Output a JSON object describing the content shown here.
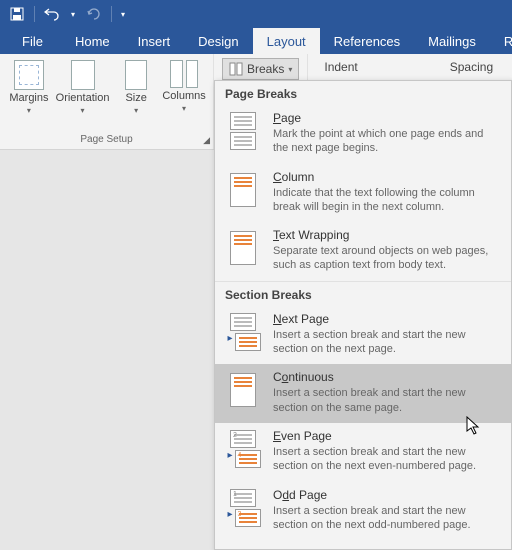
{
  "titlebar": {
    "save": "Save",
    "undo": "Undo",
    "redo": "Redo"
  },
  "tabs": {
    "file": "File",
    "home": "Home",
    "insert": "Insert",
    "design": "Design",
    "layout": "Layout",
    "references": "References",
    "mailings": "Mailings",
    "review": "Revie"
  },
  "ribbon": {
    "page_setup": {
      "margins": "Margins",
      "orientation": "Orientation",
      "size": "Size",
      "columns": "Columns",
      "label": "Page Setup"
    },
    "breaks_btn": "Breaks",
    "indent_label": "Indent",
    "spacing_label": "Spacing"
  },
  "dropdown": {
    "page_breaks_header": "Page Breaks",
    "section_breaks_header": "Section Breaks",
    "items": {
      "page": {
        "title_pre": "",
        "title_u": "P",
        "title_post": "age",
        "desc": "Mark the point at which one page ends and the next page begins."
      },
      "column": {
        "title_pre": "",
        "title_u": "C",
        "title_post": "olumn",
        "desc": "Indicate that the text following the column break will begin in the next column."
      },
      "text_wrapping": {
        "title_pre": "",
        "title_u": "T",
        "title_post": "ext Wrapping",
        "desc": "Separate text around objects on web pages, such as caption text from body text."
      },
      "next_page": {
        "title_pre": "",
        "title_u": "N",
        "title_post": "ext Page",
        "desc": "Insert a section break and start the new section on the next page."
      },
      "continuous": {
        "title_pre": "C",
        "title_u": "o",
        "title_post": "ntinuous",
        "desc": "Insert a section break and start the new section on the same page."
      },
      "even_page": {
        "title_pre": "",
        "title_u": "E",
        "title_post": "ven Page",
        "desc": "Insert a section break and start the new section on the next even-numbered page."
      },
      "odd_page": {
        "title_pre": "O",
        "title_u": "d",
        "title_post": "d Page",
        "desc": "Insert a section break and start the new section on the next odd-numbered page."
      }
    }
  }
}
